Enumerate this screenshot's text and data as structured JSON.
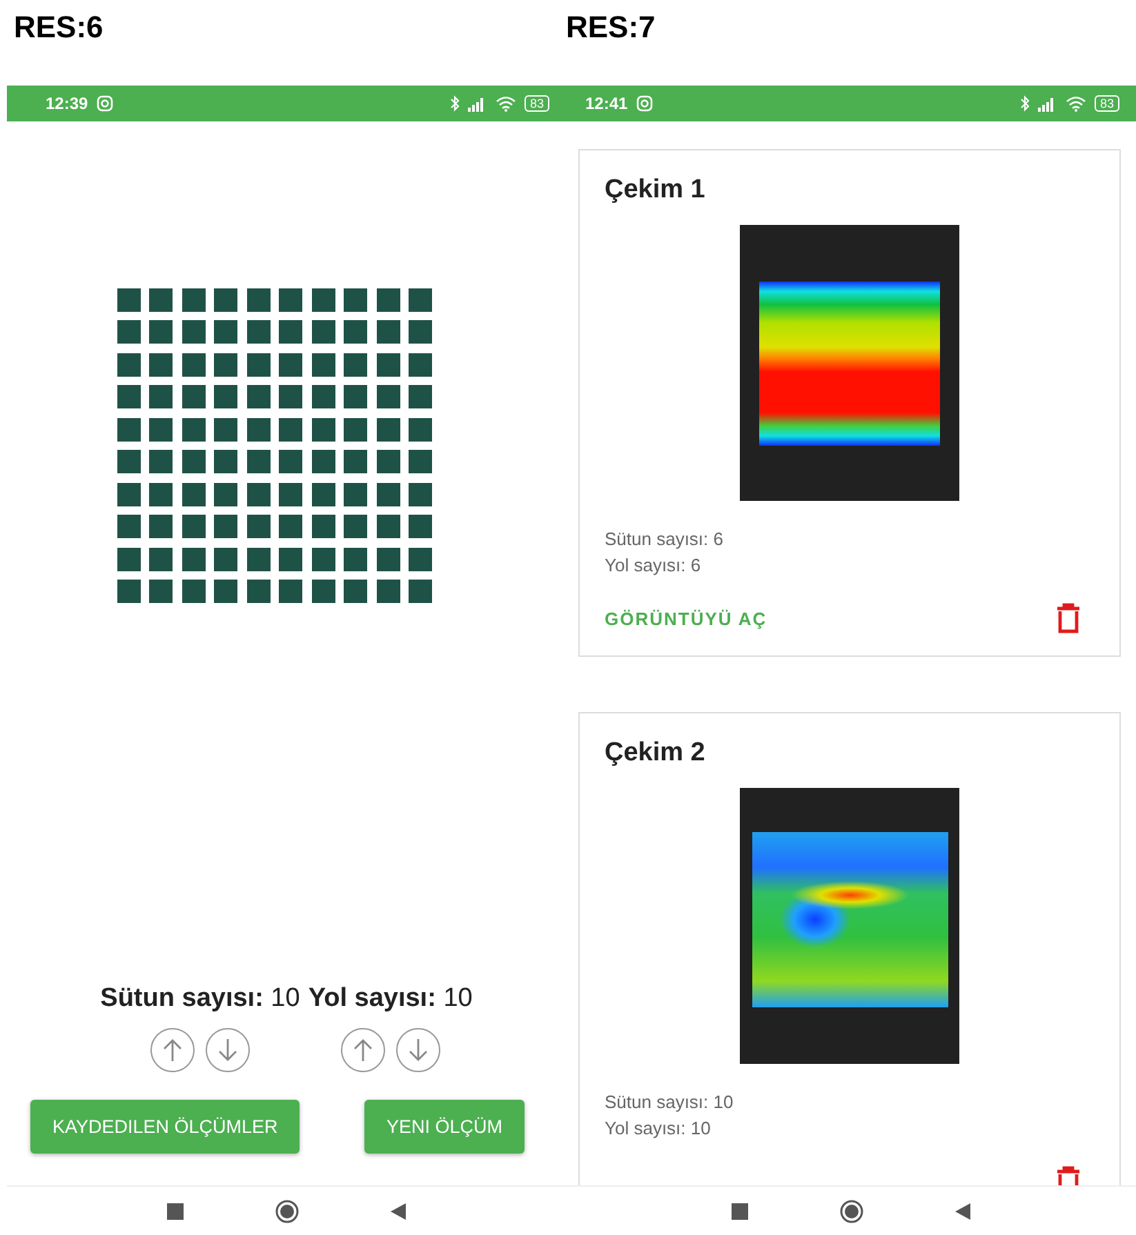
{
  "panels": [
    {
      "label": "RES:6",
      "status_bar": {
        "time": "12:39",
        "battery": "83"
      },
      "screen": {
        "kind": "grid",
        "counters": [
          {
            "label": "Sütun sayısı:",
            "value": "10"
          },
          {
            "label": "Yol sayısı:",
            "value": "10"
          }
        ],
        "buttons": [
          "KAYDEDILEN ÖLÇÜMLER",
          "YENI ÖLÇÜM"
        ]
      }
    },
    {
      "label": "RES:7",
      "status_bar": {
        "time": "12:41",
        "battery": "83"
      },
      "screen": {
        "kind": "list",
        "cards": [
          {
            "title": "Çekim 1",
            "kind": "smooth",
            "columns": "Sütun sayısı: 6",
            "rows": "Yol sayısı: 6",
            "action": "GÖRÜNTÜYÜ AÇ"
          },
          {
            "title": "Çekim 2",
            "kind": "patchy",
            "columns": "Sütun sayısı: 10",
            "rows": "Yol sayısı: 10"
          }
        ]
      }
    }
  ]
}
